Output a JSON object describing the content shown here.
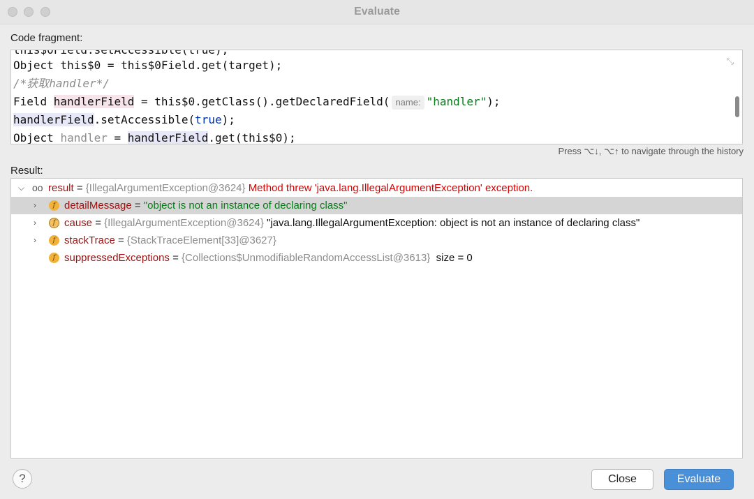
{
  "window": {
    "title": "Evaluate"
  },
  "code_panel": {
    "label": "Code fragment:",
    "lines": [
      {
        "a": "Object this$0 = this$0Field.get(target);"
      },
      {
        "comment": "/*获取handler*/"
      },
      {
        "p1": "Field ",
        "hl": "handlerField",
        "p2": " = this$0.getClass().getDeclaredField(",
        "hint": "name:",
        "str": "\"handler\"",
        "p3": ");"
      },
      {
        "hl": "handlerField",
        "p1": ".setAccessible(",
        "kw": "true",
        "p2": ");"
      },
      {
        "p1": "Object ",
        "grey": "handler",
        "p2": " = ",
        "hl": "handlerField",
        "p3": ".get(this$0);"
      }
    ],
    "history_hint": "Press ⌥↓, ⌥↑ to navigate through the history"
  },
  "result_panel": {
    "label": "Result:",
    "root": {
      "name": "result",
      "eq": " = ",
      "ref": "{IllegalArgumentException@3624}",
      "message": "Method threw 'java.lang.IllegalArgumentException' exception."
    },
    "children": [
      {
        "name": "detailMessage",
        "eq": " = ",
        "value": "\"object is not an instance of declaring class\""
      },
      {
        "name": "cause",
        "eq": " = ",
        "ref": "{IllegalArgumentException@3624}",
        "value": "\"java.lang.IllegalArgumentException: object is not an instance of declaring class\""
      },
      {
        "name": "stackTrace",
        "eq": " = ",
        "ref": "{StackTraceElement[33]@3627}"
      },
      {
        "name": "suppressedExceptions",
        "eq": " = ",
        "ref": "{Collections$UnmodifiableRandomAccessList@3613}",
        "value": "size = 0"
      }
    ]
  },
  "footer": {
    "help_label": "?",
    "close_label": "Close",
    "evaluate_label": "Evaluate"
  },
  "colors": {
    "accent": "#4a90d9",
    "error": "#d40000",
    "string": "#067d17"
  }
}
